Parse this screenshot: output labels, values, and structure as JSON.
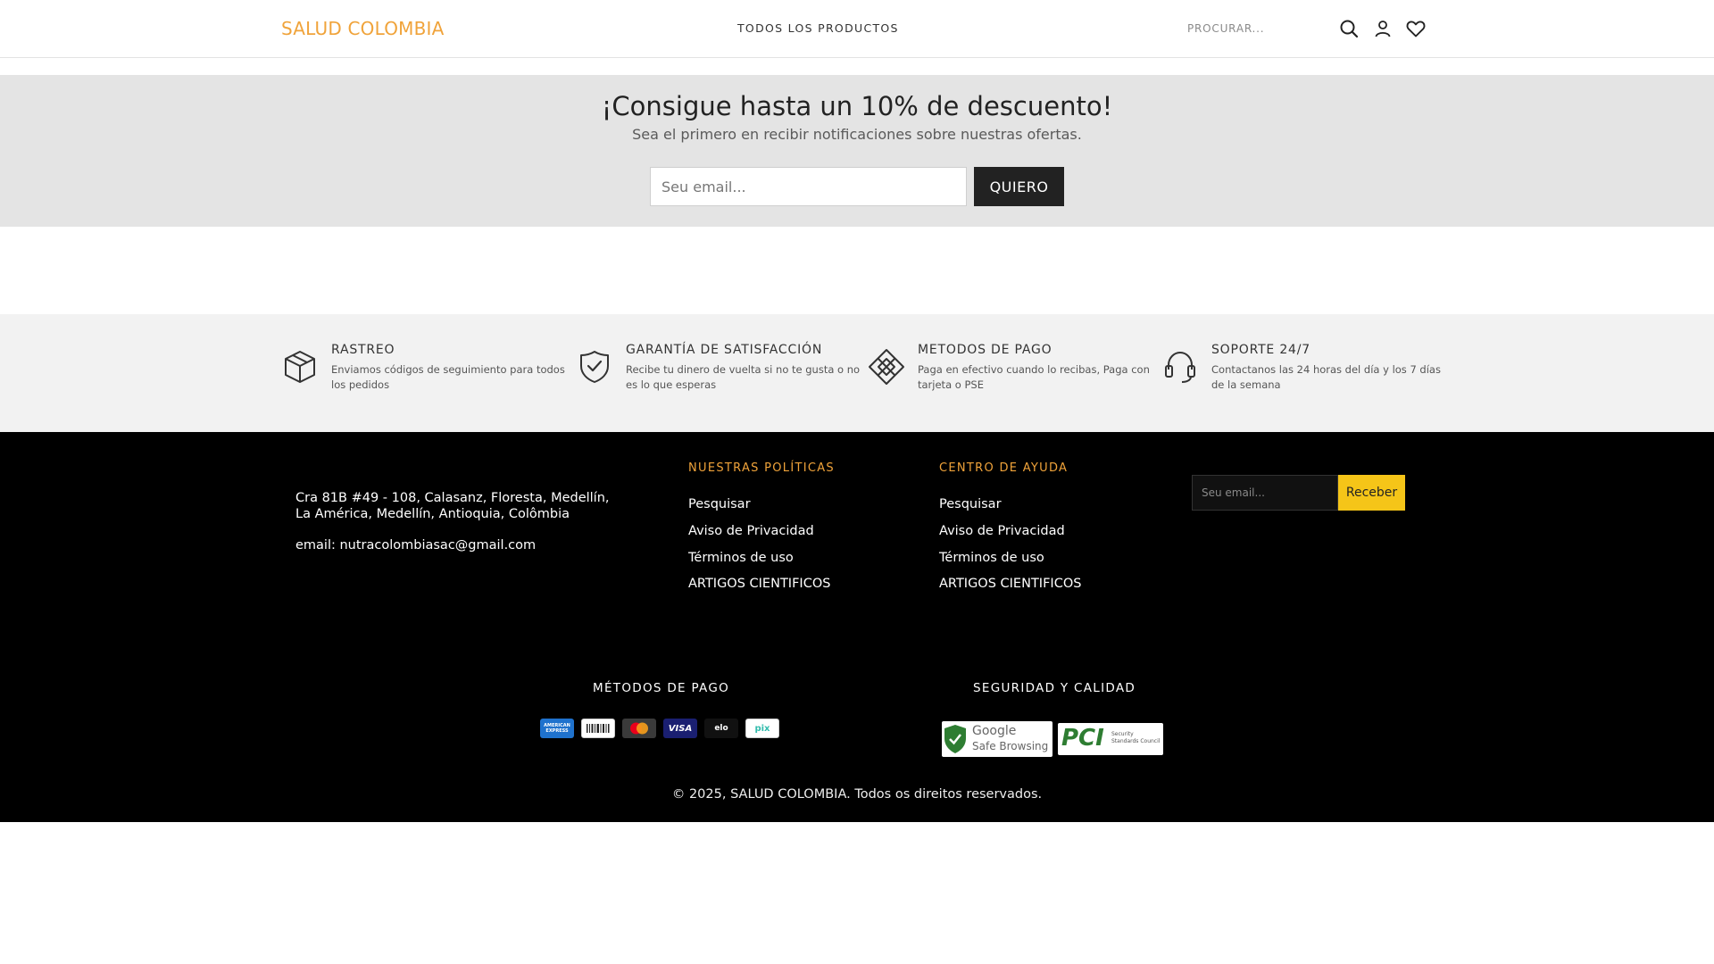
{
  "header": {
    "logo": "SALUD COLOMBIA",
    "nav_all_products": "TODOS LOS PRODUCTOS",
    "search_placeholder": "PROCURAR..."
  },
  "newsletter": {
    "title": "¡Consigue hasta un 10% de descuento!",
    "subtitle": "Sea el primero en recibir notificaciones sobre nuestras ofertas.",
    "email_placeholder": "Seu email...",
    "button": "QUIERO"
  },
  "features": [
    {
      "icon": "box-icon",
      "title": "RASTREO",
      "desc": "Enviamos códigos de seguimiento para todos los pedidos"
    },
    {
      "icon": "shield-check-icon",
      "title": "GARANTÍA DE SATISFACCIÓN",
      "desc": "Recibe tu dinero de vuelta si no te gusta o no es lo que esperas"
    },
    {
      "icon": "diamond-grid-icon",
      "title": "METODOS DE PAGO",
      "desc": "Paga en efectivo cuando lo recibas, Paga con tarjeta o PSE"
    },
    {
      "icon": "headset-icon",
      "title": "SOPORTE 24/7",
      "desc": "Contactanos las 24 horas del día y los 7 días de la semana"
    }
  ],
  "footer": {
    "address": "Cra 81B #49 - 108, Calasanz, Floresta, Medellín, La América, Medellín, Antioquia, Colômbia",
    "email": "email: nutracolombiasac@gmail.com",
    "policies": {
      "title": "NUESTRAS POLÍTICAS",
      "links": [
        "Pesquisar",
        "Aviso de Privacidad",
        "Términos de uso",
        "ARTIGOS CIENTIFICOS"
      ]
    },
    "help": {
      "title": "CENTRO DE AYUDA",
      "links": [
        "Pesquisar",
        "Aviso de Privacidad",
        "Términos de uso",
        "ARTIGOS CIENTIFICOS"
      ]
    },
    "subscribe": {
      "placeholder": "Seu email...",
      "button": "Receber"
    },
    "payment_title": "MÉTODOS DE PAGO",
    "payment_methods": [
      "AMERICAN EXPRESS",
      "boleto",
      "mastercard",
      "VISA",
      "elo",
      "pix"
    ],
    "security_title": "SEGURIDAD Y CALIDAD",
    "security_badges": {
      "google_line1": "Google",
      "google_line2": "Safe Browsing",
      "pci": "PCI",
      "pci_sub1": "Security",
      "pci_sub2": "Standards Council"
    },
    "copyright": "© 2025, SALUD COLOMBIA. Todos os direitos reservados."
  },
  "colors": {
    "brand": "#f0a33a",
    "newsletter_bg": "#e4e4e4",
    "features_bg": "#f2f2f2",
    "footer_bg": "#000000",
    "subscribe_button": "#f5c518"
  }
}
